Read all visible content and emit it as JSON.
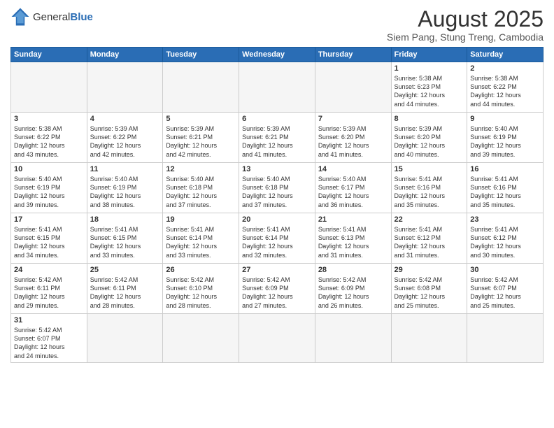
{
  "logo": {
    "general": "General",
    "blue": "Blue"
  },
  "title": "August 2025",
  "subtitle": "Siem Pang, Stung Treng, Cambodia",
  "days_of_week": [
    "Sunday",
    "Monday",
    "Tuesday",
    "Wednesday",
    "Thursday",
    "Friday",
    "Saturday"
  ],
  "weeks": [
    [
      {
        "day": "",
        "info": ""
      },
      {
        "day": "",
        "info": ""
      },
      {
        "day": "",
        "info": ""
      },
      {
        "day": "",
        "info": ""
      },
      {
        "day": "",
        "info": ""
      },
      {
        "day": "1",
        "info": "Sunrise: 5:38 AM\nSunset: 6:23 PM\nDaylight: 12 hours\nand 44 minutes."
      },
      {
        "day": "2",
        "info": "Sunrise: 5:38 AM\nSunset: 6:22 PM\nDaylight: 12 hours\nand 44 minutes."
      }
    ],
    [
      {
        "day": "3",
        "info": "Sunrise: 5:38 AM\nSunset: 6:22 PM\nDaylight: 12 hours\nand 43 minutes."
      },
      {
        "day": "4",
        "info": "Sunrise: 5:39 AM\nSunset: 6:22 PM\nDaylight: 12 hours\nand 42 minutes."
      },
      {
        "day": "5",
        "info": "Sunrise: 5:39 AM\nSunset: 6:21 PM\nDaylight: 12 hours\nand 42 minutes."
      },
      {
        "day": "6",
        "info": "Sunrise: 5:39 AM\nSunset: 6:21 PM\nDaylight: 12 hours\nand 41 minutes."
      },
      {
        "day": "7",
        "info": "Sunrise: 5:39 AM\nSunset: 6:20 PM\nDaylight: 12 hours\nand 41 minutes."
      },
      {
        "day": "8",
        "info": "Sunrise: 5:39 AM\nSunset: 6:20 PM\nDaylight: 12 hours\nand 40 minutes."
      },
      {
        "day": "9",
        "info": "Sunrise: 5:40 AM\nSunset: 6:19 PM\nDaylight: 12 hours\nand 39 minutes."
      }
    ],
    [
      {
        "day": "10",
        "info": "Sunrise: 5:40 AM\nSunset: 6:19 PM\nDaylight: 12 hours\nand 39 minutes."
      },
      {
        "day": "11",
        "info": "Sunrise: 5:40 AM\nSunset: 6:19 PM\nDaylight: 12 hours\nand 38 minutes."
      },
      {
        "day": "12",
        "info": "Sunrise: 5:40 AM\nSunset: 6:18 PM\nDaylight: 12 hours\nand 37 minutes."
      },
      {
        "day": "13",
        "info": "Sunrise: 5:40 AM\nSunset: 6:18 PM\nDaylight: 12 hours\nand 37 minutes."
      },
      {
        "day": "14",
        "info": "Sunrise: 5:40 AM\nSunset: 6:17 PM\nDaylight: 12 hours\nand 36 minutes."
      },
      {
        "day": "15",
        "info": "Sunrise: 5:41 AM\nSunset: 6:16 PM\nDaylight: 12 hours\nand 35 minutes."
      },
      {
        "day": "16",
        "info": "Sunrise: 5:41 AM\nSunset: 6:16 PM\nDaylight: 12 hours\nand 35 minutes."
      }
    ],
    [
      {
        "day": "17",
        "info": "Sunrise: 5:41 AM\nSunset: 6:15 PM\nDaylight: 12 hours\nand 34 minutes."
      },
      {
        "day": "18",
        "info": "Sunrise: 5:41 AM\nSunset: 6:15 PM\nDaylight: 12 hours\nand 33 minutes."
      },
      {
        "day": "19",
        "info": "Sunrise: 5:41 AM\nSunset: 6:14 PM\nDaylight: 12 hours\nand 33 minutes."
      },
      {
        "day": "20",
        "info": "Sunrise: 5:41 AM\nSunset: 6:14 PM\nDaylight: 12 hours\nand 32 minutes."
      },
      {
        "day": "21",
        "info": "Sunrise: 5:41 AM\nSunset: 6:13 PM\nDaylight: 12 hours\nand 31 minutes."
      },
      {
        "day": "22",
        "info": "Sunrise: 5:41 AM\nSunset: 6:12 PM\nDaylight: 12 hours\nand 31 minutes."
      },
      {
        "day": "23",
        "info": "Sunrise: 5:41 AM\nSunset: 6:12 PM\nDaylight: 12 hours\nand 30 minutes."
      }
    ],
    [
      {
        "day": "24",
        "info": "Sunrise: 5:42 AM\nSunset: 6:11 PM\nDaylight: 12 hours\nand 29 minutes."
      },
      {
        "day": "25",
        "info": "Sunrise: 5:42 AM\nSunset: 6:11 PM\nDaylight: 12 hours\nand 28 minutes."
      },
      {
        "day": "26",
        "info": "Sunrise: 5:42 AM\nSunset: 6:10 PM\nDaylight: 12 hours\nand 28 minutes."
      },
      {
        "day": "27",
        "info": "Sunrise: 5:42 AM\nSunset: 6:09 PM\nDaylight: 12 hours\nand 27 minutes."
      },
      {
        "day": "28",
        "info": "Sunrise: 5:42 AM\nSunset: 6:09 PM\nDaylight: 12 hours\nand 26 minutes."
      },
      {
        "day": "29",
        "info": "Sunrise: 5:42 AM\nSunset: 6:08 PM\nDaylight: 12 hours\nand 25 minutes."
      },
      {
        "day": "30",
        "info": "Sunrise: 5:42 AM\nSunset: 6:07 PM\nDaylight: 12 hours\nand 25 minutes."
      }
    ],
    [
      {
        "day": "31",
        "info": "Sunrise: 5:42 AM\nSunset: 6:07 PM\nDaylight: 12 hours\nand 24 minutes."
      },
      {
        "day": "",
        "info": ""
      },
      {
        "day": "",
        "info": ""
      },
      {
        "day": "",
        "info": ""
      },
      {
        "day": "",
        "info": ""
      },
      {
        "day": "",
        "info": ""
      },
      {
        "day": "",
        "info": ""
      }
    ]
  ]
}
